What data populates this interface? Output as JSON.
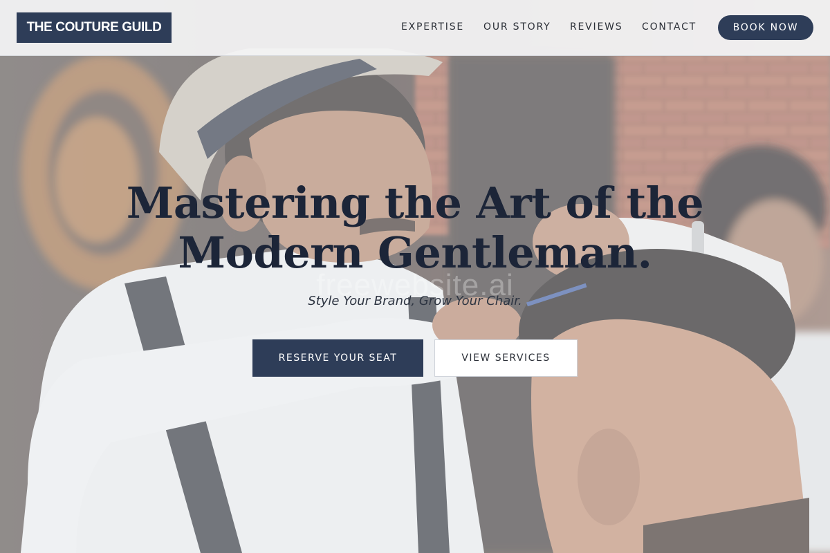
{
  "brand": {
    "logo_text": "THE COUTURE GUILD",
    "primary_color": "#2e3d58",
    "headline_color": "#1c2538"
  },
  "nav": {
    "items": [
      {
        "label": "EXPERTISE"
      },
      {
        "label": "OUR STORY"
      },
      {
        "label": "REVIEWS"
      },
      {
        "label": "CONTACT"
      }
    ],
    "cta_label": "BOOK NOW"
  },
  "hero": {
    "headline_line1": "Mastering the Art of the",
    "headline_line2": "Modern Gentleman.",
    "tagline": "Style Your Brand, Grow Your Chair.",
    "primary_cta": "RESERVE YOUR SEAT",
    "secondary_cta": "VIEW SERVICES",
    "background_image": "barber-cutting-client-hair-photo",
    "watermark": "freewebsite.ai"
  }
}
